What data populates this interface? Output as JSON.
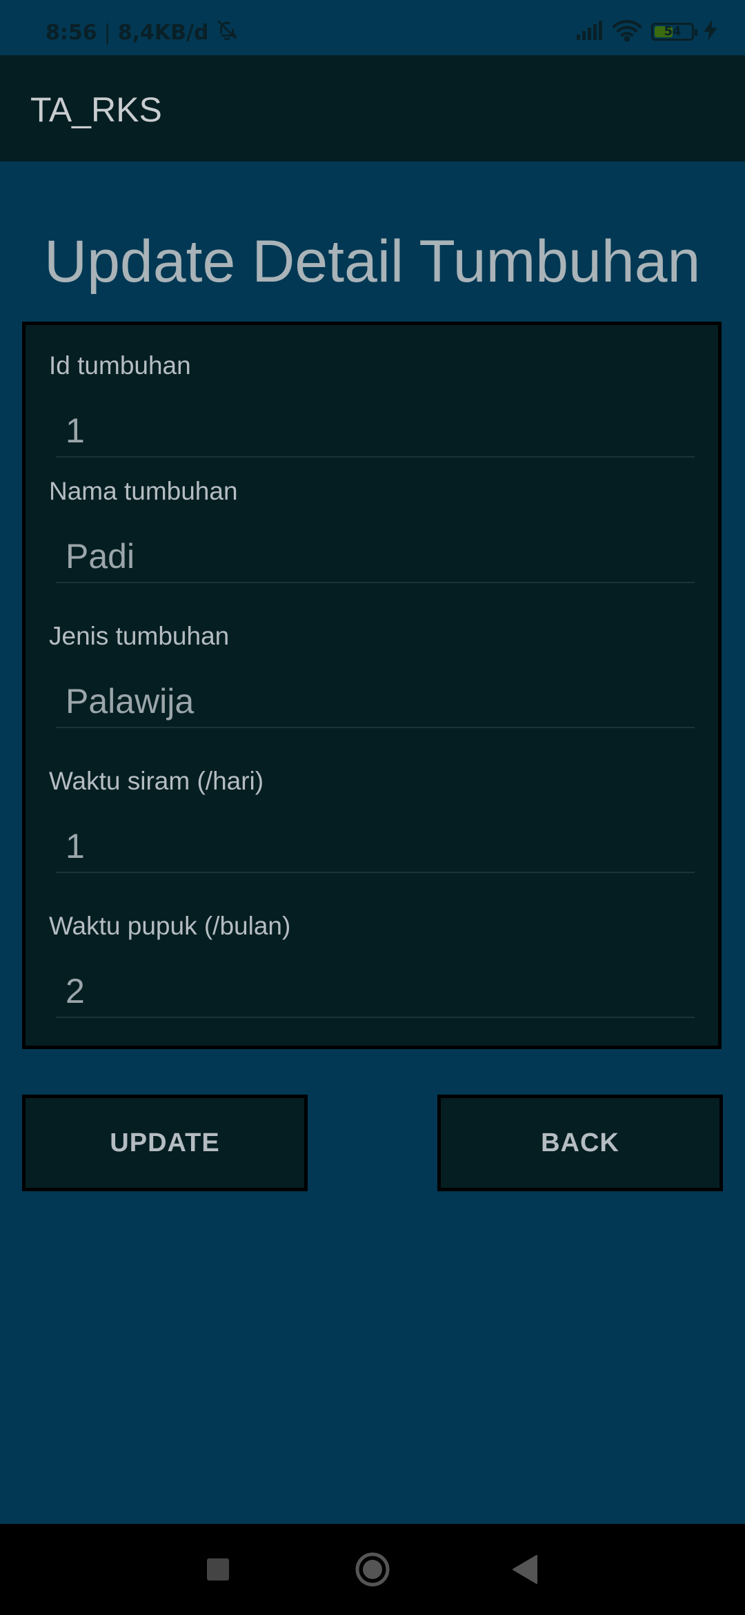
{
  "status_bar": {
    "time": "8:56",
    "separator": "|",
    "data_rate": "8,4KB/d",
    "battery_level": "54"
  },
  "app_bar": {
    "title": "TA_RKS"
  },
  "page": {
    "title": "Update Detail Tumbuhan"
  },
  "form": {
    "fields": [
      {
        "label": "Id tumbuhan",
        "value": "1"
      },
      {
        "label": "Nama tumbuhan",
        "value": "Padi"
      },
      {
        "label": "Jenis tumbuhan",
        "value": "Palawija"
      },
      {
        "label": "Waktu siram (/hari)",
        "value": "1"
      },
      {
        "label": "Waktu pupuk (/bulan)",
        "value": "2"
      }
    ]
  },
  "buttons": {
    "update_label": "UPDATE",
    "back_label": "BACK"
  },
  "colors": {
    "background": "#023853",
    "card": "#051e22",
    "text": "#b5bdc2",
    "battery_fill": "#3b6b10"
  },
  "icons": {
    "notification_muted": "bell-off-icon",
    "signal": "signal-icon",
    "wifi": "wifi-icon",
    "battery": "battery-icon",
    "charging": "lightning-icon",
    "nav_recents": "square-icon",
    "nav_home": "circle-icon",
    "nav_back": "triangle-back-icon"
  }
}
